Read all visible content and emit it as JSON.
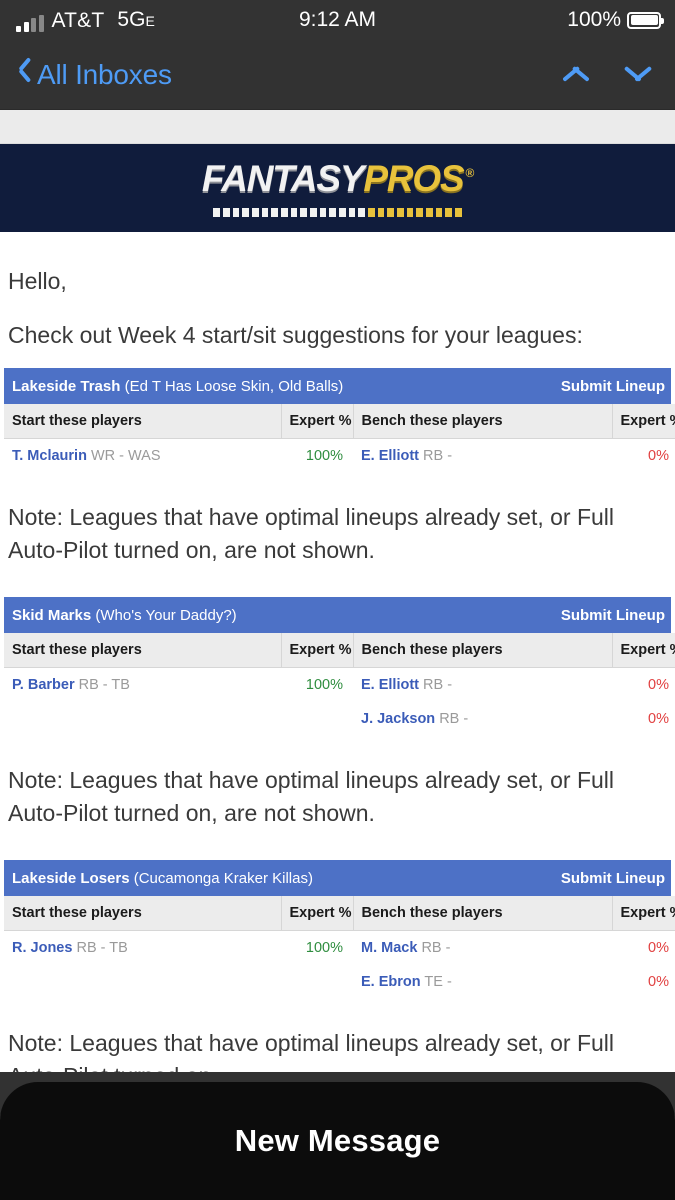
{
  "status_bar": {
    "carrier": "AT&T",
    "network": "5G",
    "network_sub": "E",
    "time": "9:12 AM",
    "battery_text": "100%",
    "battery_level": 100
  },
  "nav_bar": {
    "back_label": "All Inboxes",
    "up_icon": "chevron-up-icon",
    "down_icon": "chevron-down-icon",
    "back_icon": "chevron-left-icon",
    "accent_color": "#4e9bf5"
  },
  "email": {
    "brand": {
      "name_part1": "FANTASY",
      "name_part2": "PROS",
      "registered": "®",
      "bar_color": "#101c3c",
      "gold_color": "#e8c23c"
    },
    "greeting": "Hello,",
    "intro": "Check out Week 4 start/sit suggestions for your leagues:",
    "note": "Note: Leagues that have optimal lineups already set, or Full Auto-Pilot turned on, are not shown.",
    "note_truncated": "Note: Leagues that have optimal lineups already set, or Full Auto-Pilot turned on,",
    "header_accent": "#4d71c6",
    "columns": {
      "start": "Start these players",
      "expert_start": "Expert %",
      "bench": "Bench these players",
      "expert_bench": "Expert %"
    },
    "submit_label": "Submit Lineup",
    "leagues": [
      {
        "team_name": "Lakeside Trash",
        "league_name": "(Ed T Has Loose Skin, Old Balls)",
        "rows": [
          {
            "start_name": "T. Mclaurin",
            "start_meta": "WR - WAS",
            "start_pct": "100%",
            "bench_name": "E. Elliott",
            "bench_meta": "RB -",
            "bench_pct": "0%"
          }
        ]
      },
      {
        "team_name": "Skid Marks",
        "league_name": "(Who's Your Daddy?)",
        "rows": [
          {
            "start_name": "P. Barber",
            "start_meta": "RB - TB",
            "start_pct": "100%",
            "bench_name": "E. Elliott",
            "bench_meta": "RB -",
            "bench_pct": "0%"
          },
          {
            "start_name": "",
            "start_meta": "",
            "start_pct": "",
            "bench_name": "J. Jackson",
            "bench_meta": "RB -",
            "bench_pct": "0%"
          }
        ]
      },
      {
        "team_name": "Lakeside Losers",
        "league_name": "(Cucamonga Kraker Killas)",
        "rows": [
          {
            "start_name": "R. Jones",
            "start_meta": "RB - TB",
            "start_pct": "100%",
            "bench_name": "M. Mack",
            "bench_meta": "RB -",
            "bench_pct": "0%"
          },
          {
            "start_name": "",
            "start_meta": "",
            "start_pct": "",
            "bench_name": "E. Ebron",
            "bench_meta": "TE -",
            "bench_pct": "0%"
          }
        ]
      }
    ]
  },
  "toolbar": {
    "trash_icon": "trash-icon",
    "reply_icon": "reply-icon",
    "accent_color": "#2f7ff0"
  },
  "sheet": {
    "title": "New Message"
  }
}
